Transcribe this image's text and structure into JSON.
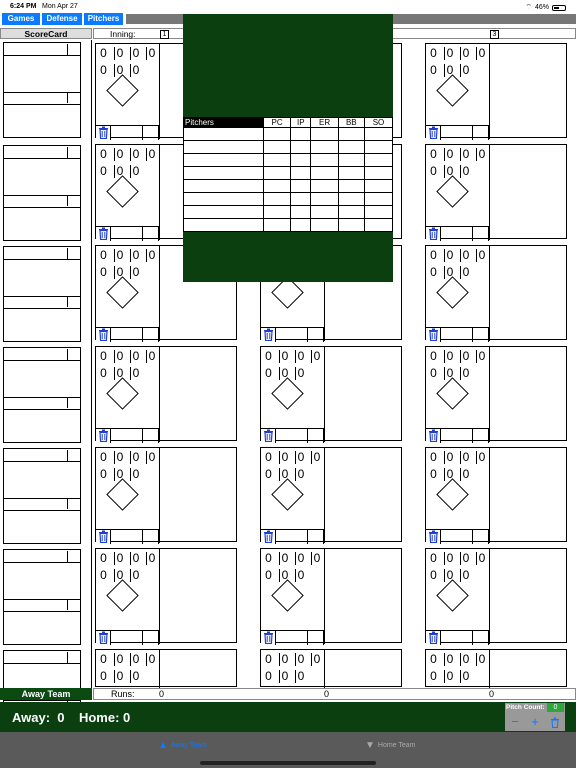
{
  "status_bar": {
    "time": "6:24 PM",
    "date": "Mon Apr 27",
    "battery": "46%",
    "battery_level": 0.46
  },
  "tabs": [
    "Games",
    "Defense",
    "Pitchers"
  ],
  "scorecard": {
    "title": "ScoreCard",
    "inning_label": "Inning:",
    "inning_numbers": [
      "1",
      "3"
    ]
  },
  "pitch_values": [
    "0",
    "0",
    "0",
    "0",
    "0",
    "0",
    "0"
  ],
  "team": {
    "label": "Away Team",
    "runs_label": "Runs:",
    "runs": [
      "0",
      "0",
      "0"
    ]
  },
  "score": {
    "text": "Away:  0    Home: 0"
  },
  "pitch_count": {
    "label": "Pitch Count:",
    "value": "0",
    "minus": "−",
    "plus": "+"
  },
  "bottom_tabs": {
    "away": "Away Team",
    "home": "Home Team"
  },
  "pitchers_table": {
    "headers": [
      "Pitchers",
      "PC",
      "IP",
      "ER",
      "BB",
      "SO"
    ],
    "row_count": 8
  },
  "colors": {
    "tab_blue": "#0a7bff",
    "dark_green": "#0b3f10",
    "team_green": "#0b4b12",
    "count_green": "#2ea63a"
  }
}
